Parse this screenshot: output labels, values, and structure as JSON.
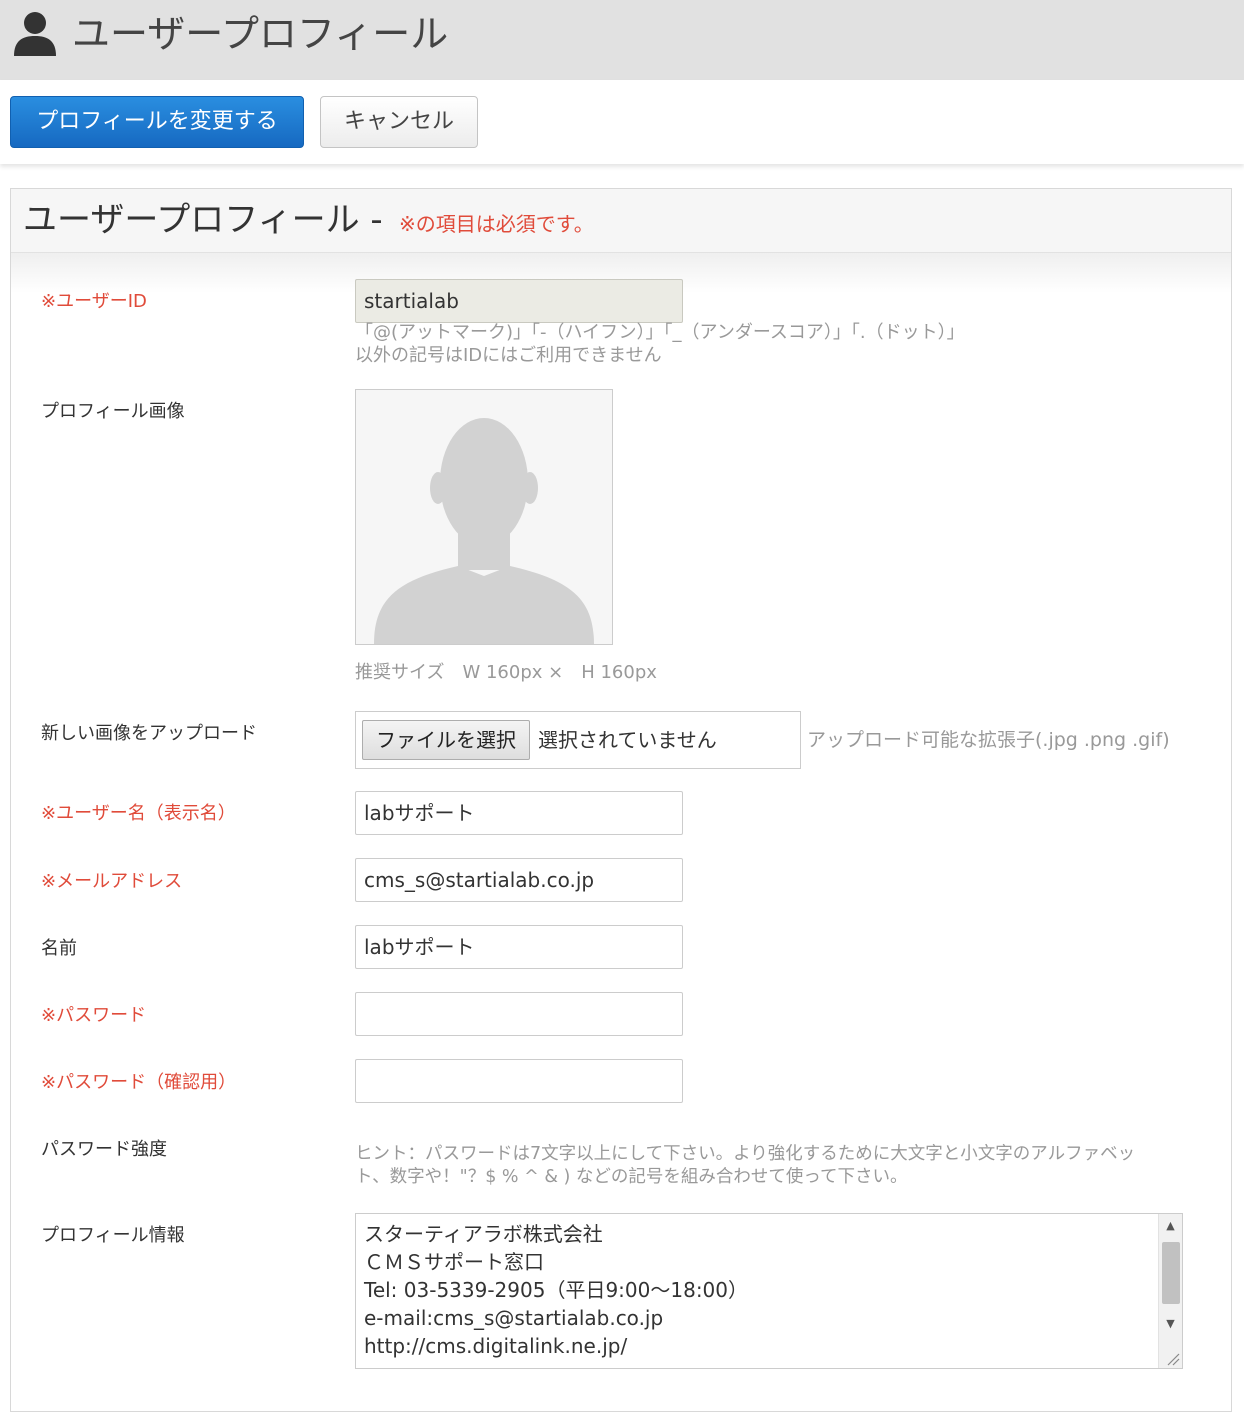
{
  "header": {
    "title": "ユーザープロフィール",
    "icon": "user-icon"
  },
  "toolbar": {
    "save_label": "プロフィールを変更する",
    "cancel_label": "キャンセル",
    "primary_color": "#1a73c9"
  },
  "panel": {
    "title": "ユーザープロフィール -",
    "required_note": "※の項目は必須です。",
    "required_color": "#e04b3a"
  },
  "form": {
    "user_id": {
      "label": "※ユーザーID",
      "value": "startialab",
      "hint_line1": "「@(アットマーク)」「-（ハイフン）」「_（アンダースコア）」「.（ドット）」",
      "hint_line2": "以外の記号はIDにはご利用できません"
    },
    "profile_image": {
      "label": "プロフィール画像",
      "size_hint": "推奨サイズ　W 160px ×　H 160px"
    },
    "upload": {
      "label": "新しい画像をアップロード",
      "button_label": "ファイルを選択",
      "status": "選択されていません",
      "extensions": "アップロード可能な拡張子(.jpg .png .gif)"
    },
    "display_name": {
      "label": "※ユーザー名（表示名）",
      "value": "labサポート"
    },
    "email": {
      "label": "※メールアドレス",
      "value": "cms_s@startialab.co.jp"
    },
    "name": {
      "label": "名前",
      "value": "labサポート"
    },
    "password": {
      "label": "※パスワード",
      "value": ""
    },
    "password_confirm": {
      "label": "※パスワード（確認用）",
      "value": ""
    },
    "password_strength": {
      "label": "パスワード強度",
      "hint_line1": "ヒント：パスワードは7文字以上にして下さい。より強化するために大文字と小文字のアルファベッ",
      "hint_line2": "ト、数字や！\"？$ % ^ & ) などの記号を組み合わせて使って下さい。"
    },
    "profile_info": {
      "label": "プロフィール情報",
      "lines": [
        "スターティアラボ株式会社",
        "ＣＭＳサポート窓口",
        "Tel: 03-5339-2905（平日9:00～18:00）",
        "e-mail:cms_s@startialab.co.jp",
        "http://cms.digitalink.ne.jp/"
      ]
    }
  }
}
